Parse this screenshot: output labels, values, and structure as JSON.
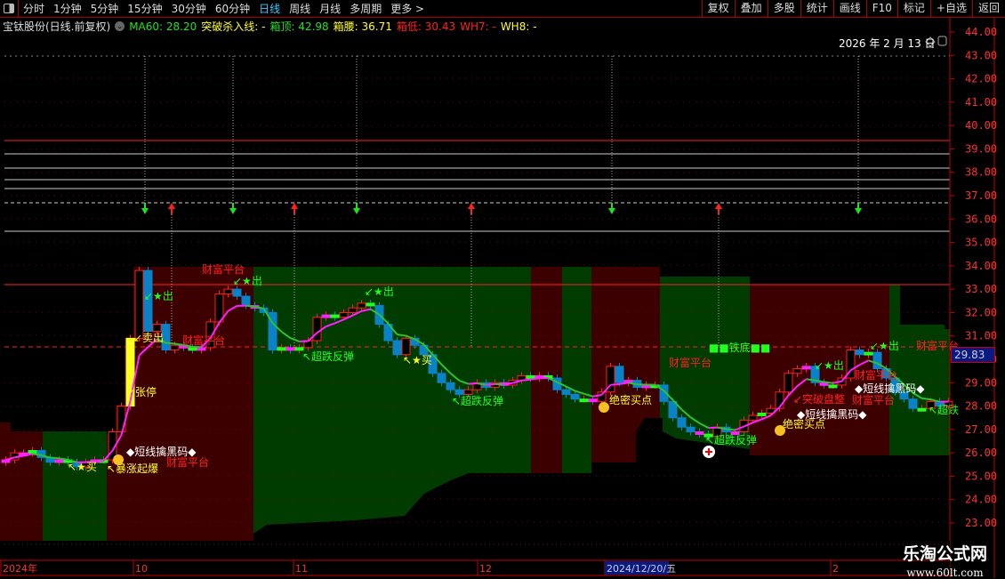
{
  "toolbar": {
    "periods": [
      "分时",
      "1分钟",
      "5分钟",
      "15分钟",
      "30分钟",
      "60分钟",
      "日线",
      "周线",
      "月线",
      "多周期",
      "更多 >"
    ],
    "active_period": "日线",
    "buttons": [
      "复权",
      "叠加",
      "多股",
      "统计",
      "画线",
      "F10",
      "标记",
      "+自选",
      "返回"
    ]
  },
  "legend": {
    "stock": "宝钛股份(日线.前复权)",
    "ma60": "MA60: 28.20",
    "breakout_line": "突破杀入线: -",
    "box_top": "箱顶: 42.98",
    "box_mid": "箱腰: 36.71",
    "box_low": "箱低: 30.43",
    "wh7": "WH7: -",
    "wh8": "WH8: -"
  },
  "colors": {
    "up": "#ff2020",
    "down": "#0a82c8",
    "ma_up": "#ff20ff",
    "ma_down": "#30c030",
    "zone_red": "#3c0000",
    "zone_green": "#003c00",
    "axis": "#c00000",
    "active": "#33ccff"
  },
  "date_label": "2026 年 2 月 13 日",
  "price_axis": {
    "ticks": [
      "44.00",
      "43.00",
      "42.00",
      "41.00",
      "40.00",
      "39.00",
      "38.00",
      "37.00",
      "36.00",
      "35.00",
      "34.00",
      "33.00",
      "32.00",
      "31.00",
      "30.00",
      "29.00",
      "28.00",
      "27.00",
      "26.00",
      "25.00",
      "24.00",
      "23.00"
    ],
    "current_price": "29.83"
  },
  "time_axis": {
    "labels": [
      "2024年",
      "10",
      "11",
      "12",
      "2024/12/20/五",
      "2"
    ]
  },
  "kline": {
    "closes": [
      25.7,
      26.0,
      26.0,
      26.1,
      25.8,
      25.6,
      25.7,
      25.6,
      25.4,
      25.6,
      25.7,
      25.7,
      26.9,
      28.0,
      30.9,
      33.8,
      31.2,
      31.5,
      30.4,
      30.6,
      30.5,
      30.4,
      30.5,
      31.6,
      32.8,
      33.0,
      32.7,
      32.3,
      32.2,
      32.0,
      30.4,
      30.5,
      30.4,
      30.5,
      30.8,
      31.8,
      31.9,
      31.8,
      32.0,
      32.2,
      32.4,
      32.3,
      31.5,
      30.8,
      30.2,
      30.9,
      30.6,
      30.2,
      29.4,
      29.0,
      28.7,
      28.5,
      28.7,
      29.0,
      28.8,
      29.0,
      28.9,
      29.1,
      29.3,
      29.2,
      29.3,
      29.2,
      28.7,
      28.5,
      28.3,
      28.3,
      28.2,
      28.6,
      29.7,
      29.0,
      29.1,
      28.8,
      28.9,
      28.9,
      28.2,
      27.5,
      27.1,
      26.9,
      26.8,
      26.7,
      27.1,
      26.9,
      26.9,
      27.4,
      27.6,
      27.7,
      27.9,
      28.6,
      29.4,
      29.6,
      29.7,
      29.0,
      28.9,
      28.9,
      29.2,
      30.4,
      30.2,
      30.3,
      29.6,
      29.2,
      28.6,
      28.3,
      27.9,
      27.9,
      28.2,
      28.0,
      28.2
    ]
  },
  "annotations": [
    {
      "text": "财富平台",
      "color": "#ff2020"
    },
    {
      "text": "财富平台",
      "color": "#ff2020"
    },
    {
      "text": "财富平台",
      "color": "#ff2020"
    },
    {
      "text": "财富平台",
      "color": "#ff2020"
    },
    {
      "text": "财富平台",
      "color": "#ff2020"
    },
    {
      "text": "财富平台",
      "color": "#ff2020"
    },
    {
      "text": "财富平台",
      "color": "#ff2020"
    },
    {
      "text": "↙★出",
      "color": "#20ff20"
    },
    {
      "text": "↙★出",
      "color": "#20ff20"
    },
    {
      "text": "↙★出",
      "color": "#20ff20"
    },
    {
      "text": "↙★出",
      "color": "#20ff20"
    },
    {
      "text": "↙★出",
      "color": "#20ff20"
    },
    {
      "text": "↙卖出",
      "color": "#ffff20"
    },
    {
      "text": "↙张停",
      "color": "#ffff20"
    },
    {
      "text": "↖★买",
      "color": "#ffff20"
    },
    {
      "text": "↖★买",
      "color": "#ffff20"
    },
    {
      "text": "◆短线擒黑码◆",
      "color": "#ffffff"
    },
    {
      "text": "◆短线擒黑码◆",
      "color": "#ffffff"
    },
    {
      "text": "◆短线擒黑码◆",
      "color": "#ffffff"
    },
    {
      "text": "↖暴涨起爆",
      "color": "#ffff20"
    },
    {
      "text": "↖超跌反弹",
      "color": "#20ff20"
    },
    {
      "text": "↖超跌反弹",
      "color": "#20ff20"
    },
    {
      "text": "↖超跌反弹",
      "color": "#20ff20"
    },
    {
      "text": "绝密买点",
      "color": "#ffff20"
    },
    {
      "text": "绝密买点",
      "color": "#ffff20"
    },
    {
      "text": "■■铁底■■",
      "color": "#20ff20"
    },
    {
      "text": "↙突破盘整",
      "color": "#ff2020"
    },
    {
      "text": "↖超跌",
      "color": "#20ff20"
    }
  ],
  "watermark": {
    "title": "乐淘公式网",
    "url": "www.60lt.com"
  }
}
